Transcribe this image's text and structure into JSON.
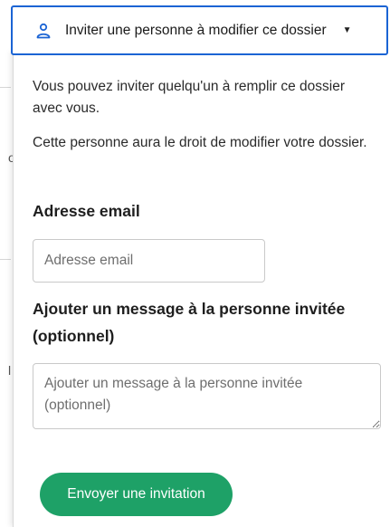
{
  "background_fragments": {
    "frag_1": "o",
    "frag_2": "l"
  },
  "invite_toggle": {
    "label": "Inviter une personne à modifier ce dossier",
    "icon": "person-icon",
    "caret_icon": "caret-down-icon",
    "border_color": "#1b64d4"
  },
  "panel": {
    "intro_1": "Vous pouvez inviter quelqu'un à remplir ce dossier avec vous.",
    "intro_2": "Cette personne aura le droit de modifier votre dossier.",
    "email_heading": "Adresse email",
    "email_placeholder": "Adresse email",
    "email_value": "",
    "message_heading": "Ajouter un message à la personne invitée (optionnel)",
    "message_placeholder": "Ajouter un message à la personne invitée (optionnel)",
    "message_value": "",
    "send_label": "Envoyer une invitation",
    "send_color": "#1ea167"
  }
}
